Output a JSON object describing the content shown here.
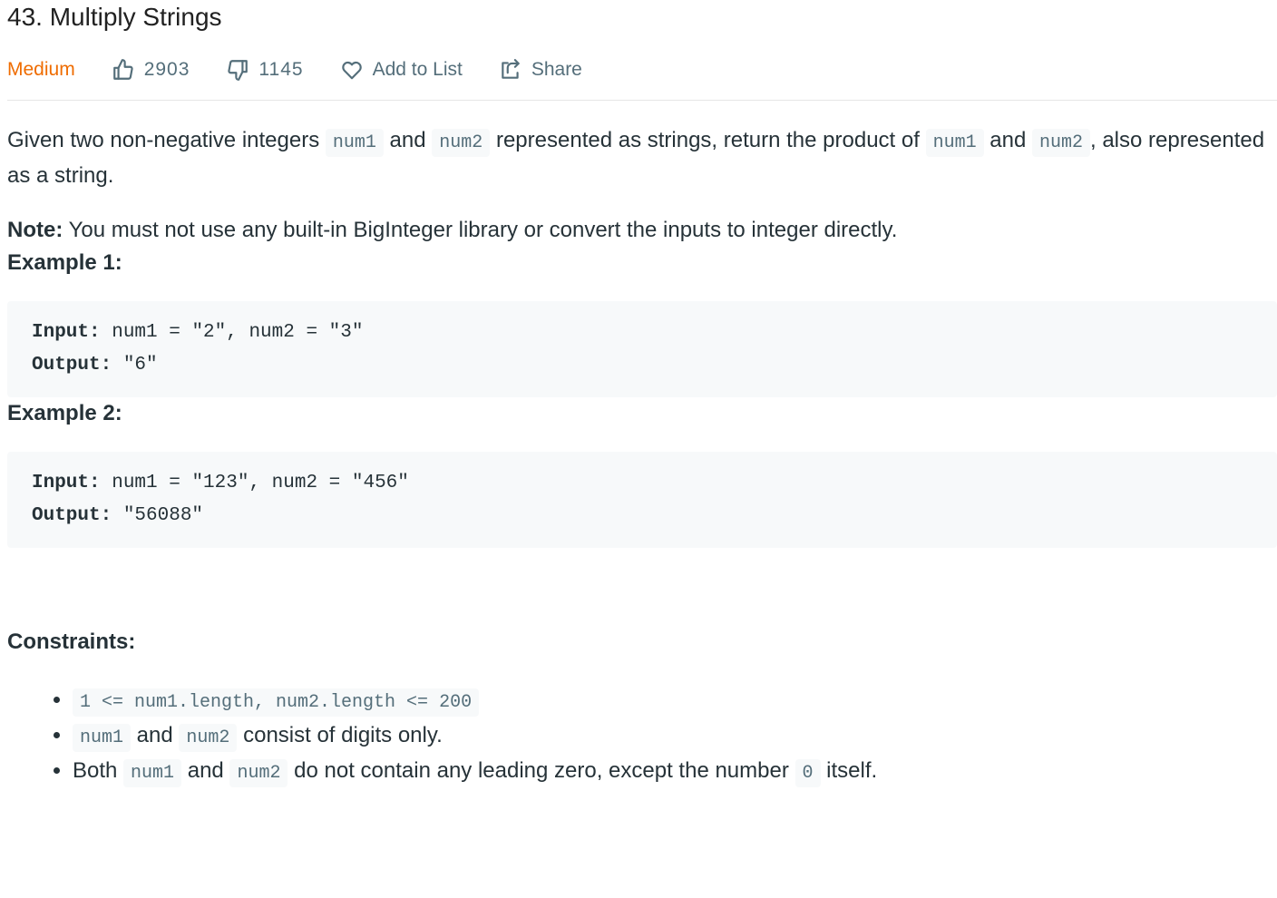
{
  "problem": {
    "title": "43. Multiply Strings",
    "difficulty": "Medium",
    "likes": "2903",
    "dislikes": "1145",
    "add_to_list": "Add to List",
    "share": "Share"
  },
  "description": {
    "t1": "Given two non-negative integers ",
    "c1": "num1",
    "t2": " and ",
    "c2": "num2",
    "t3": " represented as strings, return the product of ",
    "c3": "num1",
    "t4": " and ",
    "c4": "num2",
    "t5": ", also represented as a string."
  },
  "note": {
    "label": "Note:",
    "text": " You must not use any built-in BigInteger library or convert the inputs to integer directly."
  },
  "examples": [
    {
      "heading": "Example 1:",
      "input_label": "Input:",
      "input_value": " num1 = \"2\", num2 = \"3\"",
      "output_label": "Output:",
      "output_value": " \"6\""
    },
    {
      "heading": "Example 2:",
      "input_label": "Input:",
      "input_value": " num1 = \"123\", num2 = \"456\"",
      "output_label": "Output:",
      "output_value": " \"56088\""
    }
  ],
  "constraints": {
    "heading": "Constraints:",
    "c1_code": "1 <= num1.length, num2.length <= 200",
    "c2_code_a": "num1",
    "c2_t1": " and ",
    "c2_code_b": "num2",
    "c2_t2": " consist of digits only.",
    "c3_t1": "Both ",
    "c3_code_a": "num1",
    "c3_t2": " and ",
    "c3_code_b": "num2",
    "c3_t3": " do not contain any leading zero, except the number ",
    "c3_code_c": "0",
    "c3_t4": " itself."
  },
  "colors": {
    "difficulty_medium": "#ef6c00",
    "text": "#263238",
    "meta": "#546e7a",
    "code_bg": "#f7f9fa"
  },
  "icons": {
    "like": "thumbs-up-icon",
    "dislike": "thumbs-down-icon",
    "add_to_list": "heart-icon",
    "share": "share-icon"
  }
}
